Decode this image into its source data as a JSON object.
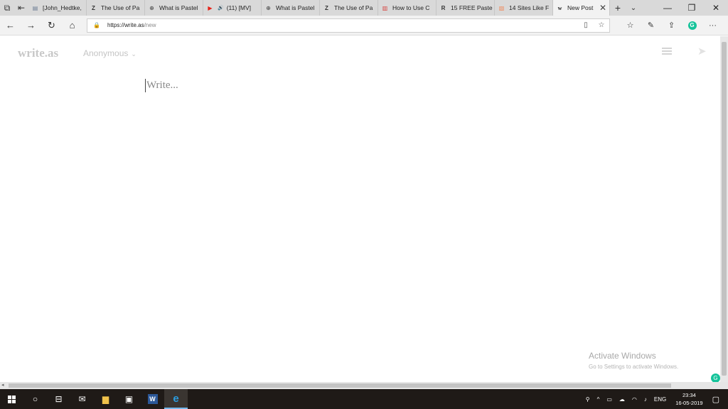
{
  "tabs": [
    {
      "label": "[John_Hedtke,",
      "icon": "document-icon",
      "fav": "▤",
      "fav_color": "#6b7c93"
    },
    {
      "label": "The Use of Pa",
      "icon": "z-logo-icon",
      "fav": "Z",
      "fav_color": "#333333"
    },
    {
      "label": "What is Pastel",
      "icon": "clock-circle-icon",
      "fav": "⊕",
      "fav_color": "#555555"
    },
    {
      "label": "(11) [MV]",
      "icon": "youtube-icon",
      "fav": "▶",
      "fav_color": "#e62117",
      "extra": "🔊"
    },
    {
      "label": "What is Pastel",
      "icon": "clock-circle-icon",
      "fav": "⊕",
      "fav_color": "#555555"
    },
    {
      "label": "The Use of Pa",
      "icon": "z-logo-icon",
      "fav": "Z",
      "fav_color": "#333333"
    },
    {
      "label": "How to Use C",
      "icon": "book-icon",
      "fav": "▥",
      "fav_color": "#d64541"
    },
    {
      "label": "15 FREE Paste",
      "icon": "r-logo-icon",
      "fav": "R",
      "fav_color": "#333333"
    },
    {
      "label": "14 Sites Like F",
      "icon": "orange-logo-icon",
      "fav": "▧",
      "fav_color": "#f08a5d"
    }
  ],
  "active_tab": {
    "label": "New Post",
    "fav": "w"
  },
  "url": {
    "host": "https://write.as",
    "path": "/new"
  },
  "brand": "write.as",
  "account": "Anonymous",
  "editor_placeholder": "Write...",
  "watermark": {
    "title": "Activate Windows",
    "subtitle": "Go to Settings to activate Windows."
  },
  "taskbar": {
    "time": "23:34",
    "date": "16-05-2019",
    "lang": "ENG"
  }
}
